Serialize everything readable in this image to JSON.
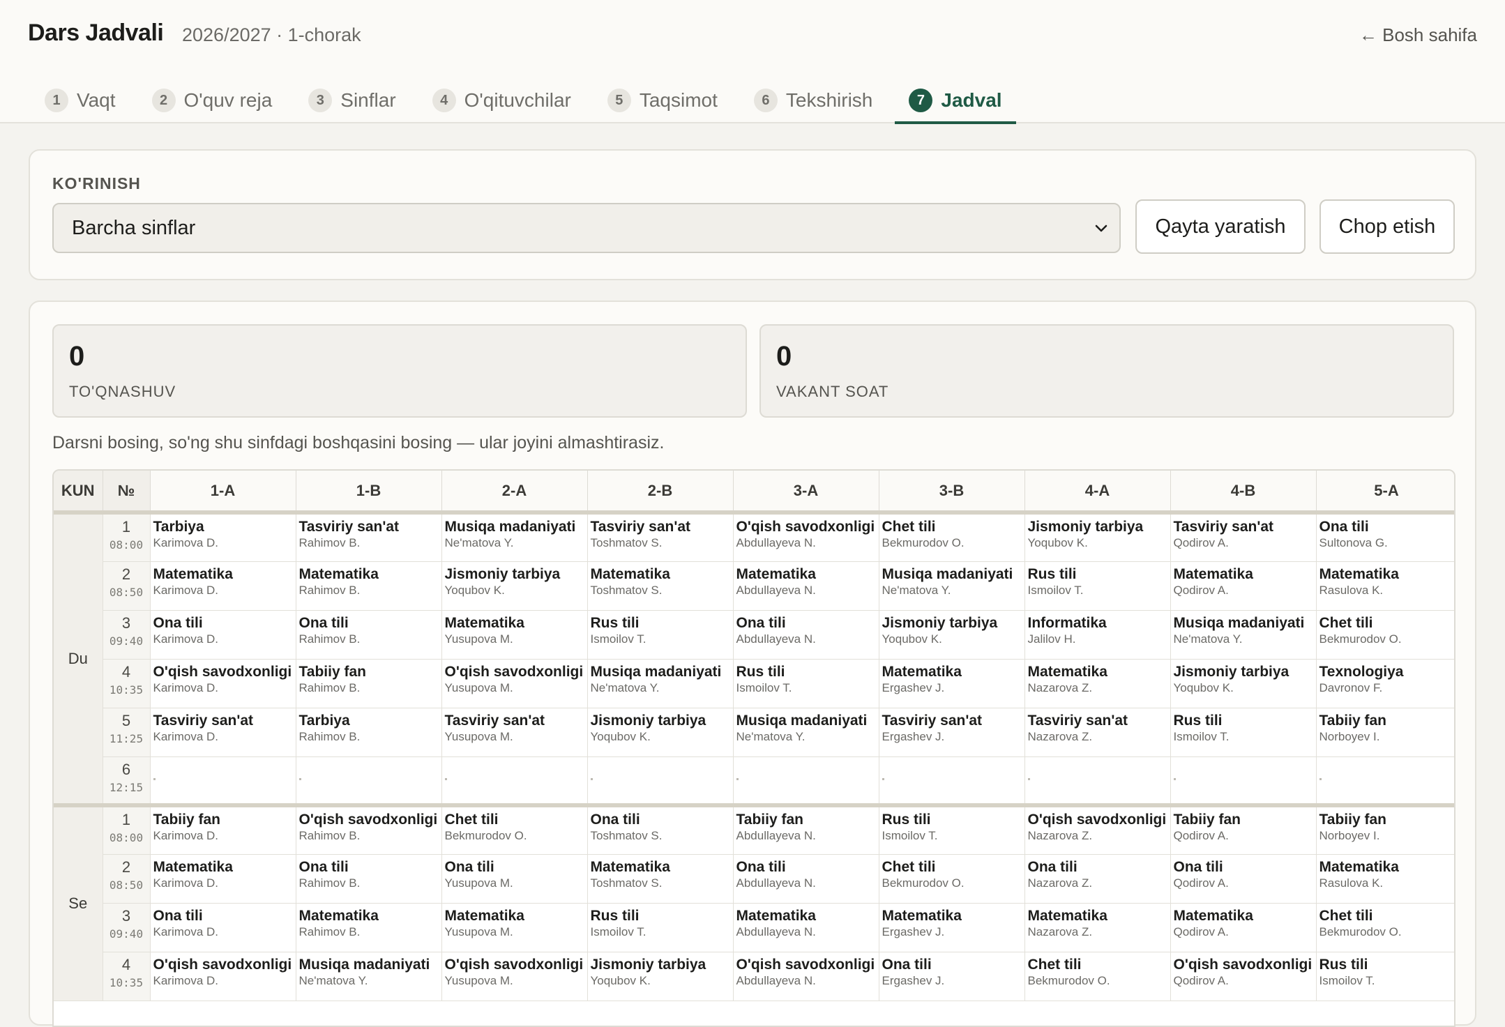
{
  "header": {
    "title": "Dars Jadvali",
    "subtitle": "2026/2027 · 1-chorak",
    "home_link": "← Bosh sahifa"
  },
  "tabs": [
    {
      "num": "1",
      "label": "Vaqt",
      "active": false
    },
    {
      "num": "2",
      "label": "O'quv reja",
      "active": false
    },
    {
      "num": "3",
      "label": "Sinflar",
      "active": false
    },
    {
      "num": "4",
      "label": "O'qituvchilar",
      "active": false
    },
    {
      "num": "5",
      "label": "Taqsimot",
      "active": false
    },
    {
      "num": "6",
      "label": "Tekshirish",
      "active": false
    },
    {
      "num": "7",
      "label": "Jadval",
      "active": true
    }
  ],
  "view": {
    "label": "KO'RINISH",
    "selected": "Barcha sinflar",
    "regenerate_label": "Qayta yaratish",
    "print_label": "Chop etish"
  },
  "stats": {
    "conflicts_value": "0",
    "conflicts_label": "TO'QNASHUV",
    "vacant_value": "0",
    "vacant_label": "VAKANT SOAT"
  },
  "hint": "Darsni bosing, so'ng shu sinfdagi boshqasini bosing — ular joyini almashtirasiz.",
  "schedule": {
    "col_day": "KUN",
    "col_num": "№",
    "classes": [
      "1-A",
      "1-B",
      "2-A",
      "2-B",
      "3-A",
      "3-B",
      "4-A",
      "4-B",
      "5-A"
    ],
    "days": [
      {
        "name": "Du",
        "periods": [
          {
            "num": "1",
            "time": "08:00",
            "lessons": [
              {
                "subject": "Tarbiya",
                "teacher": "Karimova D."
              },
              {
                "subject": "Tasviriy san'at",
                "teacher": "Rahimov B."
              },
              {
                "subject": "Musiqa madaniyati",
                "teacher": "Ne'matova Y."
              },
              {
                "subject": "Tasviriy san'at",
                "teacher": "Toshmatov S."
              },
              {
                "subject": "O'qish savodxonligi",
                "teacher": "Abdullayeva N."
              },
              {
                "subject": "Chet tili",
                "teacher": "Bekmurodov O."
              },
              {
                "subject": "Jismoniy tarbiya",
                "teacher": "Yoqubov K."
              },
              {
                "subject": "Tasviriy san'at",
                "teacher": "Qodirov A."
              },
              {
                "subject": "Ona tili",
                "teacher": "Sultonova G."
              }
            ]
          },
          {
            "num": "2",
            "time": "08:50",
            "lessons": [
              {
                "subject": "Matematika",
                "teacher": "Karimova D."
              },
              {
                "subject": "Matematika",
                "teacher": "Rahimov B."
              },
              {
                "subject": "Jismoniy tarbiya",
                "teacher": "Yoqubov K."
              },
              {
                "subject": "Matematika",
                "teacher": "Toshmatov S."
              },
              {
                "subject": "Matematika",
                "teacher": "Abdullayeva N."
              },
              {
                "subject": "Musiqa madaniyati",
                "teacher": "Ne'matova Y."
              },
              {
                "subject": "Rus tili",
                "teacher": "Ismoilov T."
              },
              {
                "subject": "Matematika",
                "teacher": "Qodirov A."
              },
              {
                "subject": "Matematika",
                "teacher": "Rasulova K."
              }
            ]
          },
          {
            "num": "3",
            "time": "09:40",
            "lessons": [
              {
                "subject": "Ona tili",
                "teacher": "Karimova D."
              },
              {
                "subject": "Ona tili",
                "teacher": "Rahimov B."
              },
              {
                "subject": "Matematika",
                "teacher": "Yusupova M."
              },
              {
                "subject": "Rus tili",
                "teacher": "Ismoilov T."
              },
              {
                "subject": "Ona tili",
                "teacher": "Abdullayeva N."
              },
              {
                "subject": "Jismoniy tarbiya",
                "teacher": "Yoqubov K."
              },
              {
                "subject": "Informatika",
                "teacher": "Jalilov H."
              },
              {
                "subject": "Musiqa madaniyati",
                "teacher": "Ne'matova Y."
              },
              {
                "subject": "Chet tili",
                "teacher": "Bekmurodov O."
              }
            ]
          },
          {
            "num": "4",
            "time": "10:35",
            "lessons": [
              {
                "subject": "O'qish savodxonligi",
                "teacher": "Karimova D."
              },
              {
                "subject": "Tabiiy fan",
                "teacher": "Rahimov B."
              },
              {
                "subject": "O'qish savodxonligi",
                "teacher": "Yusupova M."
              },
              {
                "subject": "Musiqa madaniyati",
                "teacher": "Ne'matova Y."
              },
              {
                "subject": "Rus tili",
                "teacher": "Ismoilov T."
              },
              {
                "subject": "Matematika",
                "teacher": "Ergashev J."
              },
              {
                "subject": "Matematika",
                "teacher": "Nazarova Z."
              },
              {
                "subject": "Jismoniy tarbiya",
                "teacher": "Yoqubov K."
              },
              {
                "subject": "Texnologiya",
                "teacher": "Davronov F."
              }
            ]
          },
          {
            "num": "5",
            "time": "11:25",
            "lessons": [
              {
                "subject": "Tasviriy san'at",
                "teacher": "Karimova D."
              },
              {
                "subject": "Tarbiya",
                "teacher": "Rahimov B."
              },
              {
                "subject": "Tasviriy san'at",
                "teacher": "Yusupova M."
              },
              {
                "subject": "Jismoniy tarbiya",
                "teacher": "Yoqubov K."
              },
              {
                "subject": "Musiqa madaniyati",
                "teacher": "Ne'matova Y."
              },
              {
                "subject": "Tasviriy san'at",
                "teacher": "Ergashev J."
              },
              {
                "subject": "Tasviriy san'at",
                "teacher": "Nazarova Z."
              },
              {
                "subject": "Rus tili",
                "teacher": "Ismoilov T."
              },
              {
                "subject": "Tabiiy fan",
                "teacher": "Norboyev I."
              }
            ]
          },
          {
            "num": "6",
            "time": "12:15",
            "lessons": [
              null,
              null,
              null,
              null,
              null,
              null,
              null,
              null,
              null
            ]
          }
        ]
      },
      {
        "name": "Se",
        "periods": [
          {
            "num": "1",
            "time": "08:00",
            "lessons": [
              {
                "subject": "Tabiiy fan",
                "teacher": "Karimova D."
              },
              {
                "subject": "O'qish savodxonligi",
                "teacher": "Rahimov B."
              },
              {
                "subject": "Chet tili",
                "teacher": "Bekmurodov O."
              },
              {
                "subject": "Ona tili",
                "teacher": "Toshmatov S."
              },
              {
                "subject": "Tabiiy fan",
                "teacher": "Abdullayeva N."
              },
              {
                "subject": "Rus tili",
                "teacher": "Ismoilov T."
              },
              {
                "subject": "O'qish savodxonligi",
                "teacher": "Nazarova Z."
              },
              {
                "subject": "Tabiiy fan",
                "teacher": "Qodirov A."
              },
              {
                "subject": "Tabiiy fan",
                "teacher": "Norboyev I."
              }
            ]
          },
          {
            "num": "2",
            "time": "08:50",
            "lessons": [
              {
                "subject": "Matematika",
                "teacher": "Karimova D."
              },
              {
                "subject": "Ona tili",
                "teacher": "Rahimov B."
              },
              {
                "subject": "Ona tili",
                "teacher": "Yusupova M."
              },
              {
                "subject": "Matematika",
                "teacher": "Toshmatov S."
              },
              {
                "subject": "Ona tili",
                "teacher": "Abdullayeva N."
              },
              {
                "subject": "Chet tili",
                "teacher": "Bekmurodov O."
              },
              {
                "subject": "Ona tili",
                "teacher": "Nazarova Z."
              },
              {
                "subject": "Ona tili",
                "teacher": "Qodirov A."
              },
              {
                "subject": "Matematika",
                "teacher": "Rasulova K."
              }
            ]
          },
          {
            "num": "3",
            "time": "09:40",
            "lessons": [
              {
                "subject": "Ona tili",
                "teacher": "Karimova D."
              },
              {
                "subject": "Matematika",
                "teacher": "Rahimov B."
              },
              {
                "subject": "Matematika",
                "teacher": "Yusupova M."
              },
              {
                "subject": "Rus tili",
                "teacher": "Ismoilov T."
              },
              {
                "subject": "Matematika",
                "teacher": "Abdullayeva N."
              },
              {
                "subject": "Matematika",
                "teacher": "Ergashev J."
              },
              {
                "subject": "Matematika",
                "teacher": "Nazarova Z."
              },
              {
                "subject": "Matematika",
                "teacher": "Qodirov A."
              },
              {
                "subject": "Chet tili",
                "teacher": "Bekmurodov O."
              }
            ]
          },
          {
            "num": "4",
            "time": "10:35",
            "lessons": [
              {
                "subject": "O'qish savodxonligi",
                "teacher": "Karimova D."
              },
              {
                "subject": "Musiqa madaniyati",
                "teacher": "Ne'matova Y."
              },
              {
                "subject": "O'qish savodxonligi",
                "teacher": "Yusupova M."
              },
              {
                "subject": "Jismoniy tarbiya",
                "teacher": "Yoqubov K."
              },
              {
                "subject": "O'qish savodxonligi",
                "teacher": "Abdullayeva N."
              },
              {
                "subject": "Ona tili",
                "teacher": "Ergashev J."
              },
              {
                "subject": "Chet tili",
                "teacher": "Bekmurodov O."
              },
              {
                "subject": "O'qish savodxonligi",
                "teacher": "Qodirov A."
              },
              {
                "subject": "Rus tili",
                "teacher": "Ismoilov T."
              }
            ]
          }
        ]
      }
    ]
  }
}
